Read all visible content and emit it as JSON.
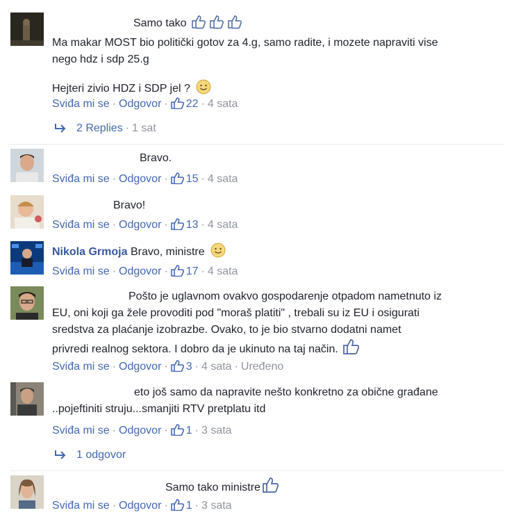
{
  "actions": {
    "like": "Sviđa mi se",
    "reply": "Odgovor"
  },
  "comments": [
    {
      "author": "",
      "text_lines": [
        "Samo tako",
        "Ma makar MOST bio politički gotov za 4.g, samo radite, i mozete napraviti vise",
        "nego hdz i sdp 25.g",
        "Hejteri zivio HDZ i SDP jel ?"
      ],
      "likes": "22",
      "time": "4 sata",
      "replies": {
        "count_label": "2 Replies",
        "time": "1 sat"
      },
      "colors": {
        "avatar": "#3a3428"
      }
    },
    {
      "author": "",
      "text": "Bravo.",
      "likes": "15",
      "time": "4 sata"
    },
    {
      "author": "",
      "text": "Bravo!",
      "likes": "13",
      "time": "4 sata"
    },
    {
      "author": "Nikola Grmoja",
      "text": "Bravo, ministre",
      "likes": "17",
      "time": "4 sata"
    },
    {
      "author": "",
      "text_lines": [
        "Pošto je uglavnom ovakvo gospodarenje otpadom nametnuto iz",
        "EU, oni koji ga žele provoditi pod \"moraš platiti\" , trebali su iz EU i osigurati",
        "sredstva za plaćanje izobrazbe. Ovako, to je bio stvarno dodatni namet",
        "privredi realnog sektora. I dobro da je ukinuto na taj način."
      ],
      "likes": "3",
      "time": "4 sata",
      "edited": "Uređeno"
    },
    {
      "author": "",
      "text_lines": [
        "eto još samo da napravite nešto konkretno za obične građane",
        "..pojeftiniti struju...smanjiti RTV pretplatu itd"
      ],
      "likes": "1",
      "time": "3 sata",
      "replies": {
        "count_label": "1 odgovor"
      }
    },
    {
      "author": "",
      "text": "Samo tako ministre",
      "likes": "1",
      "time": "3 sata"
    }
  ],
  "icons": {
    "like": "thumbs-up-icon",
    "reply": "reply-arrow-icon",
    "emoji": "smiley-icon"
  },
  "colors": {
    "link": "#4267b2",
    "author": "#365899",
    "muted": "#90949c",
    "text": "#1d2129"
  }
}
